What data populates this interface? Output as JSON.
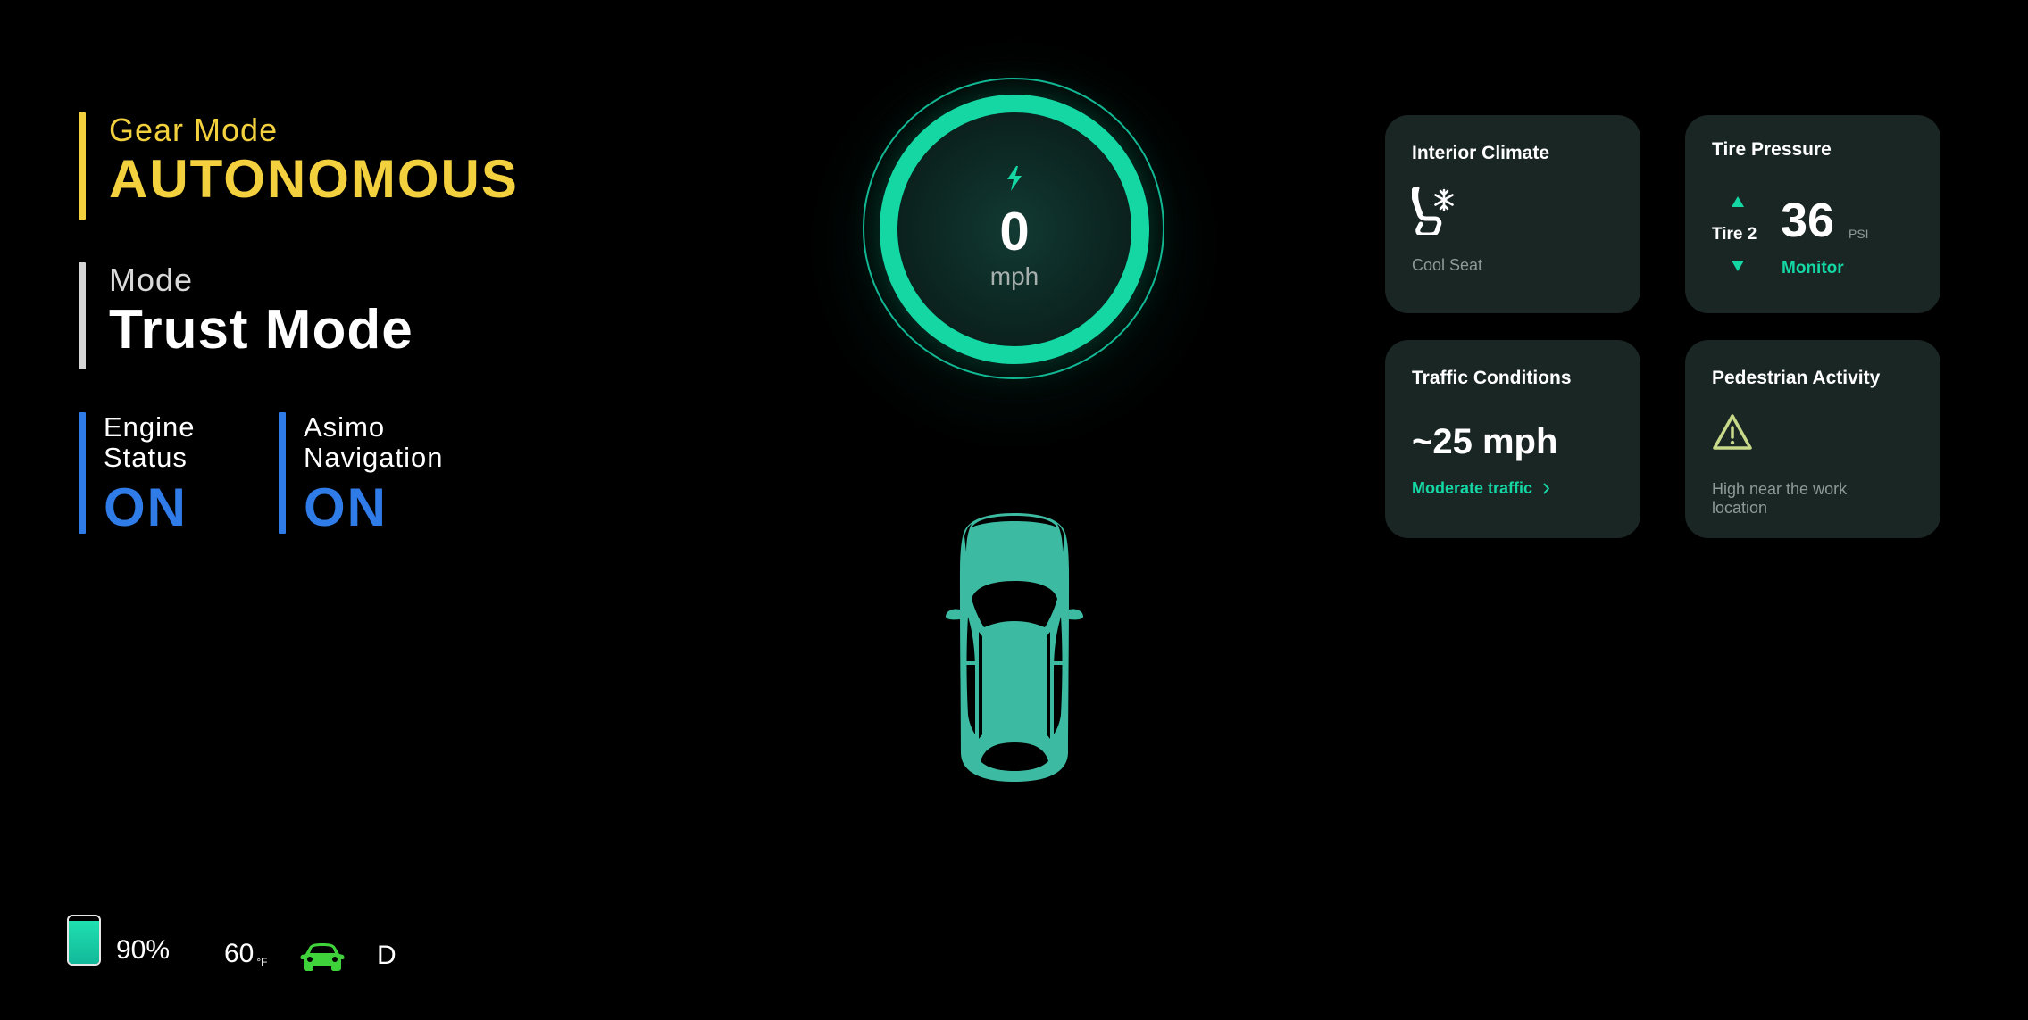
{
  "gear": {
    "label": "Gear Mode",
    "value": "AUTONOMOUS"
  },
  "mode": {
    "label": "Mode",
    "value": "Trust Mode"
  },
  "engine": {
    "label_line1": "Engine",
    "label_line2": "Status",
    "value": "ON"
  },
  "navigation": {
    "label_line1": "Asimo",
    "label_line2": "Navigation",
    "value": "ON"
  },
  "speedometer": {
    "speed": "0",
    "unit": "mph",
    "icon": "bolt-icon"
  },
  "cards": {
    "climate": {
      "title": "Interior Climate",
      "icon": "seat-snowflake-icon",
      "subtitle": "Cool Seat"
    },
    "tire": {
      "title": "Tire Pressure",
      "tire_label": "Tire 2",
      "value": "36",
      "unit": "PSI",
      "status": "Monitor"
    },
    "traffic": {
      "title": "Traffic Conditions",
      "value": "~25 mph",
      "link": "Moderate traffic"
    },
    "pedestrian": {
      "title": "Pedestrian Activity",
      "icon": "warning-triangle-icon",
      "desc_line1": "High near the work",
      "desc_line2": "location"
    }
  },
  "bottom": {
    "battery_percent": "90%",
    "battery_level": 0.9,
    "temperature": "60",
    "temperature_unit": "°F",
    "car_icon": "car-front-icon",
    "gear": "D"
  },
  "colors": {
    "accent": "#14d7a4",
    "gear_yellow": "#f2d03e",
    "status_blue": "#2f7ce8",
    "card_bg": "#1a2624",
    "car_body": "#3dbba2",
    "warning": "#c8d98a",
    "car_icon_green": "#3fd23a"
  }
}
